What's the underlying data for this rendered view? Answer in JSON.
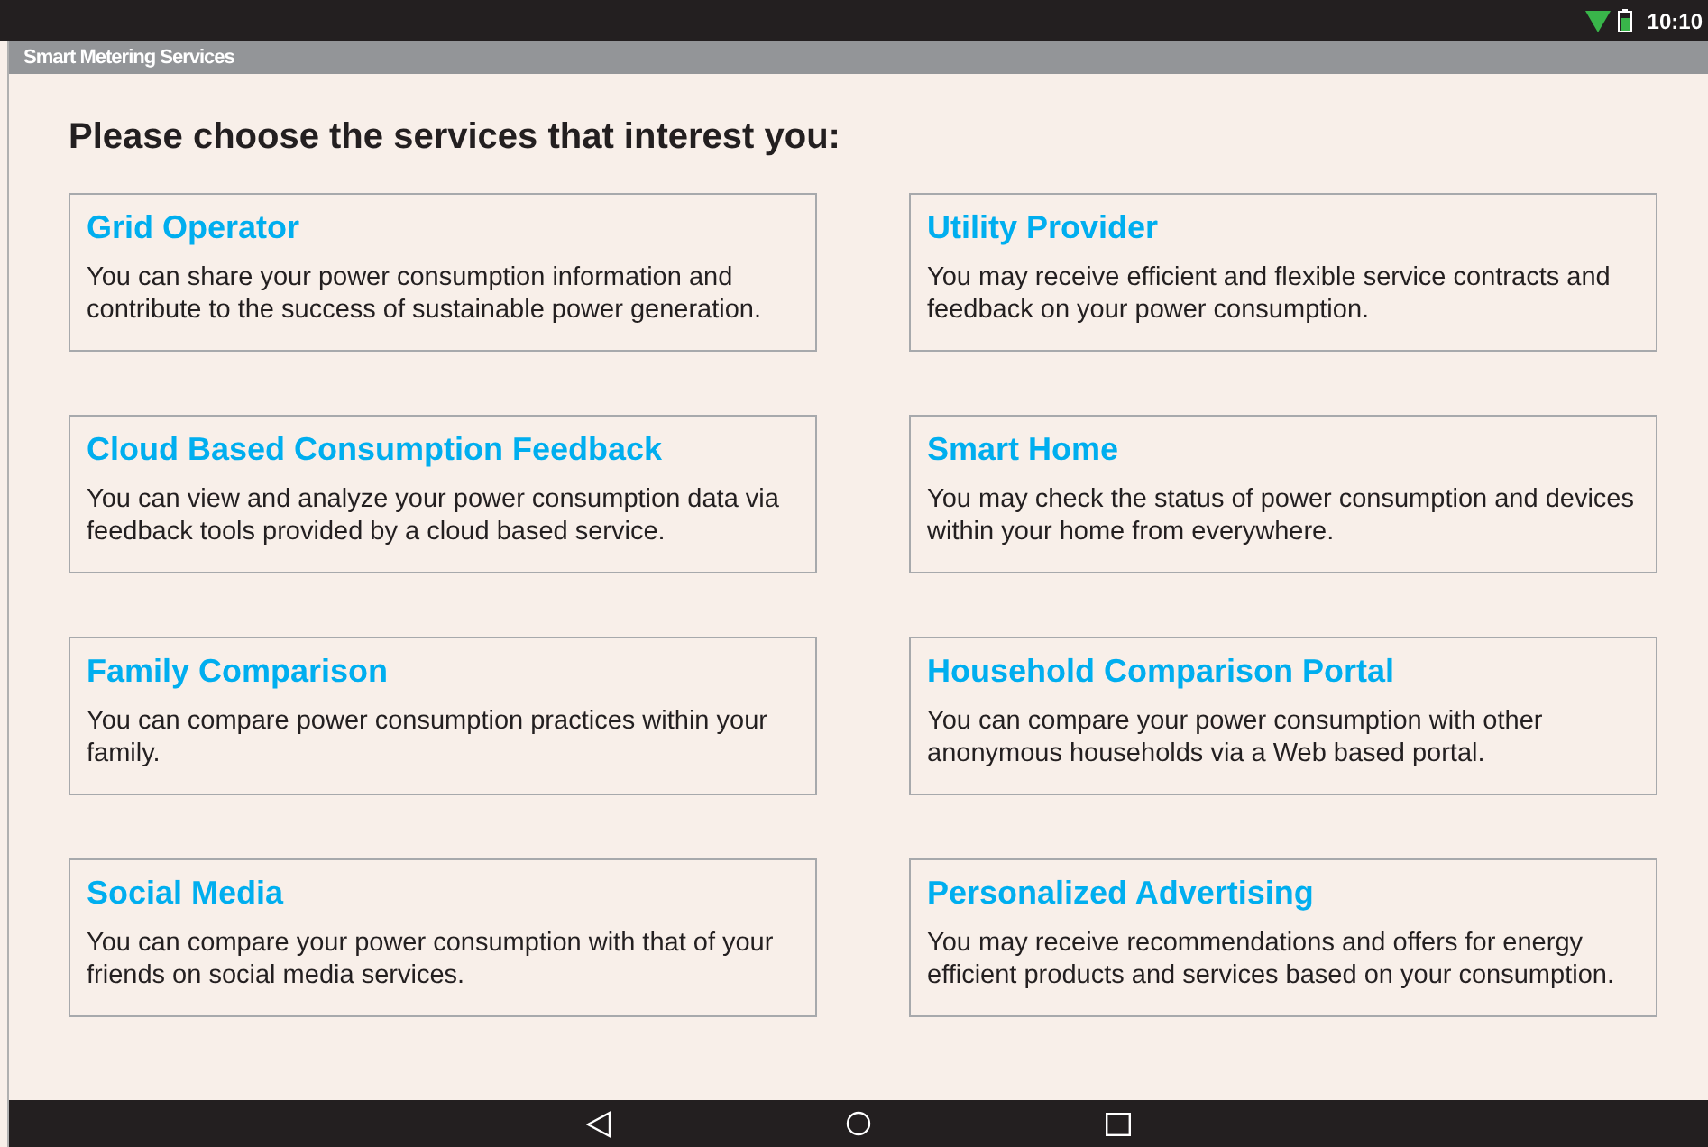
{
  "status_bar": {
    "time": "10:10"
  },
  "app_bar": {
    "title": "Smart Metering Services"
  },
  "heading": "Please choose the services that interest you:",
  "services": [
    {
      "title": "Grid Operator",
      "description": "You can share your power consumption information and contribute to the success of sustainable power generation."
    },
    {
      "title": "Utility Provider",
      "description": "You may receive efficient and flexible service contracts and feedback on your power consumption."
    },
    {
      "title": "Cloud Based Consumption Feedback",
      "description": "You can view and analyze your power consumption data via feedback tools provided by a cloud based service."
    },
    {
      "title": "Smart Home",
      "description": "You may check the status of power consumption and devices within your home from everywhere."
    },
    {
      "title": "Family Comparison",
      "description": "You can compare power consumption practices within your family."
    },
    {
      "title": "Household Comparison Portal",
      "description": "You can compare your power consumption with other anonymous households via a Web based portal."
    },
    {
      "title": "Social Media",
      "description": "You can compare your power consumption with that of your friends on social media services."
    },
    {
      "title": "Personalized Advertising",
      "description": "You may receive recommendations and offers for energy efficient products and services based on your consumption."
    }
  ]
}
